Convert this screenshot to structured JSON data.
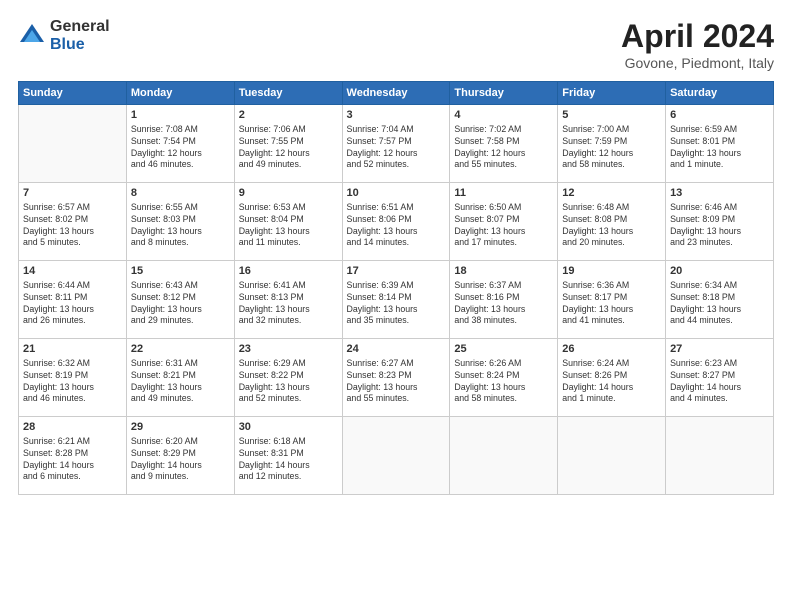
{
  "header": {
    "logo_general": "General",
    "logo_blue": "Blue",
    "title": "April 2024",
    "location": "Govone, Piedmont, Italy"
  },
  "weekdays": [
    "Sunday",
    "Monday",
    "Tuesday",
    "Wednesday",
    "Thursday",
    "Friday",
    "Saturday"
  ],
  "weeks": [
    [
      {
        "num": "",
        "info": ""
      },
      {
        "num": "1",
        "info": "Sunrise: 7:08 AM\nSunset: 7:54 PM\nDaylight: 12 hours\nand 46 minutes."
      },
      {
        "num": "2",
        "info": "Sunrise: 7:06 AM\nSunset: 7:55 PM\nDaylight: 12 hours\nand 49 minutes."
      },
      {
        "num": "3",
        "info": "Sunrise: 7:04 AM\nSunset: 7:57 PM\nDaylight: 12 hours\nand 52 minutes."
      },
      {
        "num": "4",
        "info": "Sunrise: 7:02 AM\nSunset: 7:58 PM\nDaylight: 12 hours\nand 55 minutes."
      },
      {
        "num": "5",
        "info": "Sunrise: 7:00 AM\nSunset: 7:59 PM\nDaylight: 12 hours\nand 58 minutes."
      },
      {
        "num": "6",
        "info": "Sunrise: 6:59 AM\nSunset: 8:01 PM\nDaylight: 13 hours\nand 1 minute."
      }
    ],
    [
      {
        "num": "7",
        "info": "Sunrise: 6:57 AM\nSunset: 8:02 PM\nDaylight: 13 hours\nand 5 minutes."
      },
      {
        "num": "8",
        "info": "Sunrise: 6:55 AM\nSunset: 8:03 PM\nDaylight: 13 hours\nand 8 minutes."
      },
      {
        "num": "9",
        "info": "Sunrise: 6:53 AM\nSunset: 8:04 PM\nDaylight: 13 hours\nand 11 minutes."
      },
      {
        "num": "10",
        "info": "Sunrise: 6:51 AM\nSunset: 8:06 PM\nDaylight: 13 hours\nand 14 minutes."
      },
      {
        "num": "11",
        "info": "Sunrise: 6:50 AM\nSunset: 8:07 PM\nDaylight: 13 hours\nand 17 minutes."
      },
      {
        "num": "12",
        "info": "Sunrise: 6:48 AM\nSunset: 8:08 PM\nDaylight: 13 hours\nand 20 minutes."
      },
      {
        "num": "13",
        "info": "Sunrise: 6:46 AM\nSunset: 8:09 PM\nDaylight: 13 hours\nand 23 minutes."
      }
    ],
    [
      {
        "num": "14",
        "info": "Sunrise: 6:44 AM\nSunset: 8:11 PM\nDaylight: 13 hours\nand 26 minutes."
      },
      {
        "num": "15",
        "info": "Sunrise: 6:43 AM\nSunset: 8:12 PM\nDaylight: 13 hours\nand 29 minutes."
      },
      {
        "num": "16",
        "info": "Sunrise: 6:41 AM\nSunset: 8:13 PM\nDaylight: 13 hours\nand 32 minutes."
      },
      {
        "num": "17",
        "info": "Sunrise: 6:39 AM\nSunset: 8:14 PM\nDaylight: 13 hours\nand 35 minutes."
      },
      {
        "num": "18",
        "info": "Sunrise: 6:37 AM\nSunset: 8:16 PM\nDaylight: 13 hours\nand 38 minutes."
      },
      {
        "num": "19",
        "info": "Sunrise: 6:36 AM\nSunset: 8:17 PM\nDaylight: 13 hours\nand 41 minutes."
      },
      {
        "num": "20",
        "info": "Sunrise: 6:34 AM\nSunset: 8:18 PM\nDaylight: 13 hours\nand 44 minutes."
      }
    ],
    [
      {
        "num": "21",
        "info": "Sunrise: 6:32 AM\nSunset: 8:19 PM\nDaylight: 13 hours\nand 46 minutes."
      },
      {
        "num": "22",
        "info": "Sunrise: 6:31 AM\nSunset: 8:21 PM\nDaylight: 13 hours\nand 49 minutes."
      },
      {
        "num": "23",
        "info": "Sunrise: 6:29 AM\nSunset: 8:22 PM\nDaylight: 13 hours\nand 52 minutes."
      },
      {
        "num": "24",
        "info": "Sunrise: 6:27 AM\nSunset: 8:23 PM\nDaylight: 13 hours\nand 55 minutes."
      },
      {
        "num": "25",
        "info": "Sunrise: 6:26 AM\nSunset: 8:24 PM\nDaylight: 13 hours\nand 58 minutes."
      },
      {
        "num": "26",
        "info": "Sunrise: 6:24 AM\nSunset: 8:26 PM\nDaylight: 14 hours\nand 1 minute."
      },
      {
        "num": "27",
        "info": "Sunrise: 6:23 AM\nSunset: 8:27 PM\nDaylight: 14 hours\nand 4 minutes."
      }
    ],
    [
      {
        "num": "28",
        "info": "Sunrise: 6:21 AM\nSunset: 8:28 PM\nDaylight: 14 hours\nand 6 minutes."
      },
      {
        "num": "29",
        "info": "Sunrise: 6:20 AM\nSunset: 8:29 PM\nDaylight: 14 hours\nand 9 minutes."
      },
      {
        "num": "30",
        "info": "Sunrise: 6:18 AM\nSunset: 8:31 PM\nDaylight: 14 hours\nand 12 minutes."
      },
      {
        "num": "",
        "info": ""
      },
      {
        "num": "",
        "info": ""
      },
      {
        "num": "",
        "info": ""
      },
      {
        "num": "",
        "info": ""
      }
    ]
  ]
}
